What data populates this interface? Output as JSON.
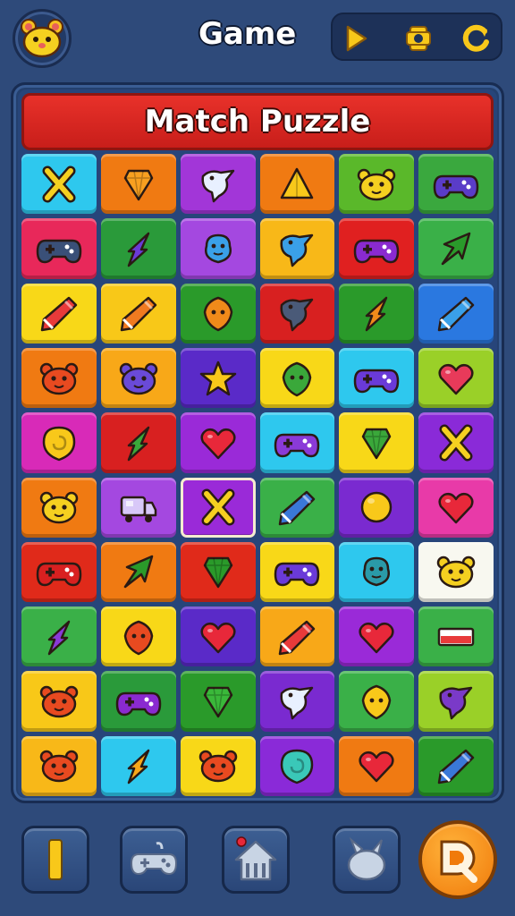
{
  "header": {
    "title": "Game",
    "avatar_icon": "hamster-face-icon",
    "controls": [
      {
        "name": "play-button",
        "icon": "play-icon"
      },
      {
        "name": "settings-button",
        "icon": "gear-icon"
      },
      {
        "name": "restart-button",
        "icon": "refresh-icon"
      }
    ]
  },
  "board": {
    "banner_title": "Match Puzzle",
    "rows": [
      [
        {
          "bg": "#2ec8ee",
          "icon": "cross",
          "c": "#f5d020"
        },
        {
          "bg": "#f07a12",
          "icon": "gem",
          "c": "#f8a020"
        },
        {
          "bg": "#a236d8",
          "icon": "bird",
          "c": "#e8f0ff"
        },
        {
          "bg": "#f07a12",
          "icon": "triangle",
          "c": "#f8c81a"
        },
        {
          "bg": "#5ab82a",
          "icon": "hamster",
          "c": "#f5d020"
        },
        {
          "bg": "#3aa83e",
          "icon": "gamepad",
          "c": "#5a3cc8"
        }
      ],
      [
        {
          "bg": "#e8285a",
          "icon": "gamepad",
          "c": "#3a5078"
        },
        {
          "bg": "#2a9a3a",
          "icon": "rocket",
          "c": "#6a3ad8"
        },
        {
          "bg": "#a448e0",
          "icon": "blob",
          "c": "#3aa0e8"
        },
        {
          "bg": "#f8b818",
          "icon": "bird",
          "c": "#3aa0e8"
        },
        {
          "bg": "#e02020",
          "icon": "gamepad",
          "c": "#8a2ad0"
        },
        {
          "bg": "#3ab048",
          "icon": "arrow",
          "c": "#2a9a2a"
        }
      ],
      [
        {
          "bg": "#f8d818",
          "icon": "pencil",
          "c": "#e83a3a"
        },
        {
          "bg": "#f8c818",
          "icon": "pencil",
          "c": "#f07a20"
        },
        {
          "bg": "#2a9a2a",
          "icon": "shield",
          "c": "#f08a1a"
        },
        {
          "bg": "#d82020",
          "icon": "bird",
          "c": "#4a5a78"
        },
        {
          "bg": "#2a9a2a",
          "icon": "rocket",
          "c": "#f08a1a"
        },
        {
          "bg": "#2a78e0",
          "icon": "pencil",
          "c": "#3aa0e8"
        }
      ],
      [
        {
          "bg": "#f07a12",
          "icon": "hamster",
          "c": "#e84a20"
        },
        {
          "bg": "#f8a818",
          "icon": "hamster",
          "c": "#6a4ad8"
        },
        {
          "bg": "#5a2ac8",
          "icon": "star",
          "c": "#f8c81a"
        },
        {
          "bg": "#f8d818",
          "icon": "shield",
          "c": "#3aa83a"
        },
        {
          "bg": "#2ec8ee",
          "icon": "gamepad",
          "c": "#6a3ad8"
        },
        {
          "bg": "#9ad028",
          "icon": "heart",
          "c": "#e83a5a"
        }
      ],
      [
        {
          "bg": "#d82ab8",
          "icon": "swirl",
          "c": "#f8c81a"
        },
        {
          "bg": "#d82020",
          "icon": "rocket",
          "c": "#3aa83a"
        },
        {
          "bg": "#9a2ad8",
          "icon": "heart",
          "c": "#e8283a"
        },
        {
          "bg": "#2ec8ee",
          "icon": "gamepad",
          "c": "#8a3ad8"
        },
        {
          "bg": "#f8d818",
          "icon": "gem",
          "c": "#3aa83a"
        },
        {
          "bg": "#8a2ad8",
          "icon": "cross",
          "c": "#f5d020"
        }
      ],
      [
        {
          "bg": "#f07a12",
          "icon": "hamster",
          "c": "#f5d020"
        },
        {
          "bg": "#a448e0",
          "icon": "truck",
          "c": "#d8c8f8"
        },
        {
          "bg": "#9a2ad8",
          "icon": "cross",
          "c": "#f5d020"
        },
        {
          "bg": "#3ab048",
          "icon": "pencil",
          "c": "#3a78d8"
        },
        {
          "bg": "#7a2ad0",
          "icon": "circle",
          "c": "#f8c81a"
        },
        {
          "bg": "#e83aa8",
          "icon": "heart",
          "c": "#e8283a"
        }
      ],
      [
        {
          "bg": "#e02a1a",
          "icon": "gamepad",
          "c": "#d82020"
        },
        {
          "bg": "#f07a12",
          "icon": "arrow",
          "c": "#2a9a2a"
        },
        {
          "bg": "#e02a1a",
          "icon": "gem",
          "c": "#2a9a2a"
        },
        {
          "bg": "#f8d818",
          "icon": "gamepad",
          "c": "#6a3ad8"
        },
        {
          "bg": "#2ec8ee",
          "icon": "blob",
          "c": "#2a9aa8"
        },
        {
          "bg": "#f8f8f0",
          "icon": "hamster",
          "c": "#f5d020"
        }
      ],
      [
        {
          "bg": "#3ab048",
          "icon": "rocket",
          "c": "#8a3ad8"
        },
        {
          "bg": "#f8d818",
          "icon": "shield",
          "c": "#e84a20"
        },
        {
          "bg": "#5a2ac8",
          "icon": "heart",
          "c": "#e8283a"
        },
        {
          "bg": "#f8a818",
          "icon": "pencil",
          "c": "#e83a3a"
        },
        {
          "bg": "#9a2ad8",
          "icon": "heart",
          "c": "#e8283a"
        },
        {
          "bg": "#3ab048",
          "icon": "flag",
          "c": "#e83a3a"
        }
      ],
      [
        {
          "bg": "#f8c818",
          "icon": "hamster",
          "c": "#e84a20"
        },
        {
          "bg": "#2a9a3a",
          "icon": "gamepad",
          "c": "#8a2ad0"
        },
        {
          "bg": "#2a9a2a",
          "icon": "gem",
          "c": "#3ab83a"
        },
        {
          "bg": "#7a2ad0",
          "icon": "bird",
          "c": "#e8f0ff"
        },
        {
          "bg": "#3ab048",
          "icon": "shield",
          "c": "#f8c81a"
        },
        {
          "bg": "#9ad028",
          "icon": "bird",
          "c": "#7a3ac8"
        }
      ],
      [
        {
          "bg": "#f8b818",
          "icon": "hamster",
          "c": "#e84a20"
        },
        {
          "bg": "#2ec8ee",
          "icon": "rocket",
          "c": "#f8a81a"
        },
        {
          "bg": "#f8d818",
          "icon": "hamster",
          "c": "#e84a20"
        },
        {
          "bg": "#8a2ad8",
          "icon": "swirl",
          "c": "#3ac8b8"
        },
        {
          "bg": "#f07a12",
          "icon": "heart",
          "c": "#e8283a"
        },
        {
          "bg": "#2a9a2a",
          "icon": "pencil",
          "c": "#3a78d8"
        }
      ]
    ]
  },
  "bottom_bar": [
    {
      "name": "pause-button",
      "icon": "pause-icon"
    },
    {
      "name": "gamepad-button",
      "icon": "gamepad-icon"
    },
    {
      "name": "home-button",
      "icon": "home-icon"
    },
    {
      "name": "bunny-button",
      "icon": "bunny-icon"
    },
    {
      "name": "hint-button",
      "icon": "magnifier-icon"
    }
  ],
  "colors": {
    "background": "#2e4a7a",
    "banner": "#e8312a",
    "accent": "#f07a0a"
  }
}
